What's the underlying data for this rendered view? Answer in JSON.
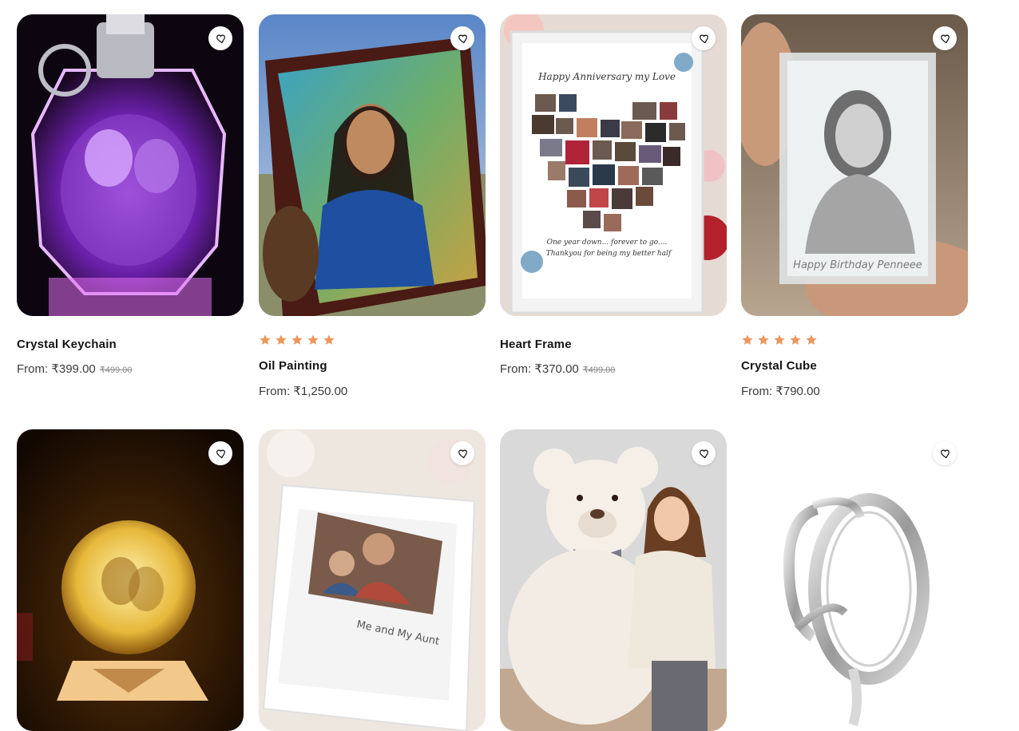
{
  "products": [
    {
      "title": "Crystal Keychain",
      "price": "From: ₹399.00",
      "old_price": "₹499.00"
    },
    {
      "title": "Oil Painting",
      "price": "From: ₹1,250.00",
      "old_price": "",
      "rating": 5
    },
    {
      "title": "Heart Frame",
      "price": "From: ₹370.00",
      "old_price": "₹499.00"
    },
    {
      "title": "Crystal Cube",
      "price": "From: ₹790.00",
      "old_price": "",
      "rating": 5
    },
    {
      "image": "moon lamp"
    },
    {
      "image": "photo frame"
    },
    {
      "image": "teddy bear"
    },
    {
      "image": "hug ring"
    }
  ],
  "thumbnail_texts": {
    "heart_frame_header": "Happy Anniversary my Love",
    "heart_frame_footer_1": "One year down... forever to go....",
    "heart_frame_footer_2": "Thankyou for being my better half",
    "crystal_cube_caption": "Happy Birthday Penneee",
    "photo_frame_caption": "Me and My Aunt"
  },
  "icons": {
    "wishlist": "heart-outline-icon",
    "rating": "star-icon"
  },
  "colors": {
    "star": "#f0955c",
    "title": "#141414",
    "price": "#3a3a3a"
  }
}
